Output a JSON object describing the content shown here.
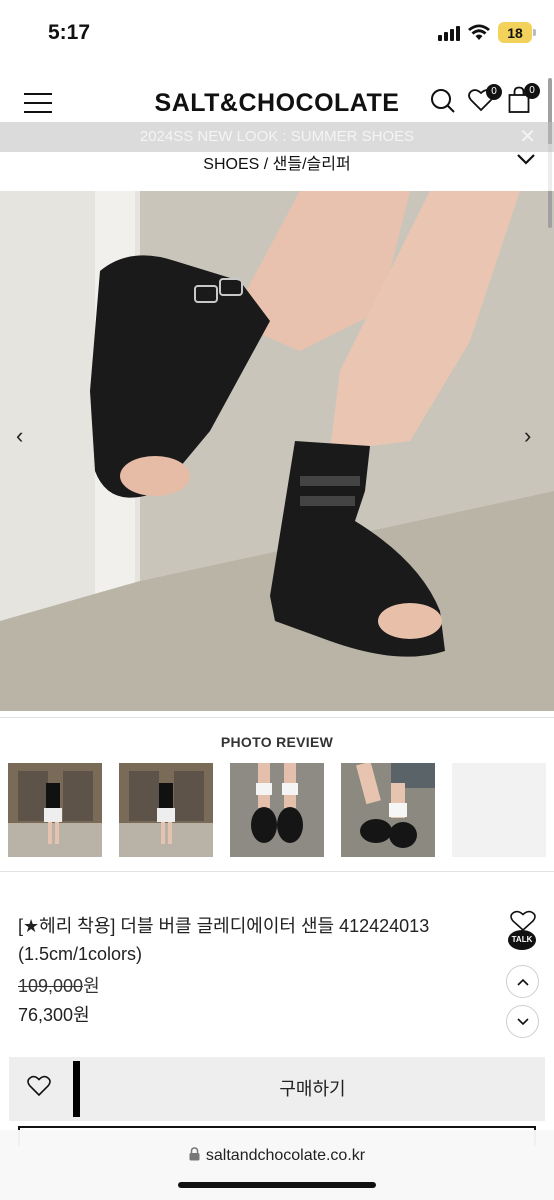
{
  "status_bar": {
    "time": "5:17",
    "battery": "18"
  },
  "header": {
    "logo": "SALT&CHOCOLATE",
    "wishlist_count": "0",
    "cart_count": "0"
  },
  "announcement": {
    "text": "2024SS NEW LOOK : SUMMER SHOES",
    "close": "✕"
  },
  "breadcrumb": {
    "category": "SHOES",
    "separator": " / ",
    "subcategory": "샌들/슬리퍼"
  },
  "photo_review": {
    "title": "PHOTO REVIEW"
  },
  "product": {
    "title": "[★헤리 착용] 더블 버클 글레디에이터 샌들 412424013 (1.5cm/1colors)",
    "original_price": "109,000",
    "sale_price": "76,300",
    "currency": "원",
    "talk_label": "TALK"
  },
  "buy_bar": {
    "buy_label": "구매하기"
  },
  "browser": {
    "url": "saltandchocolate.co.kr"
  },
  "colors": {
    "accent": "#111111",
    "buy_bar_bg": "#eeeeee",
    "battery": "#f2d25b"
  }
}
